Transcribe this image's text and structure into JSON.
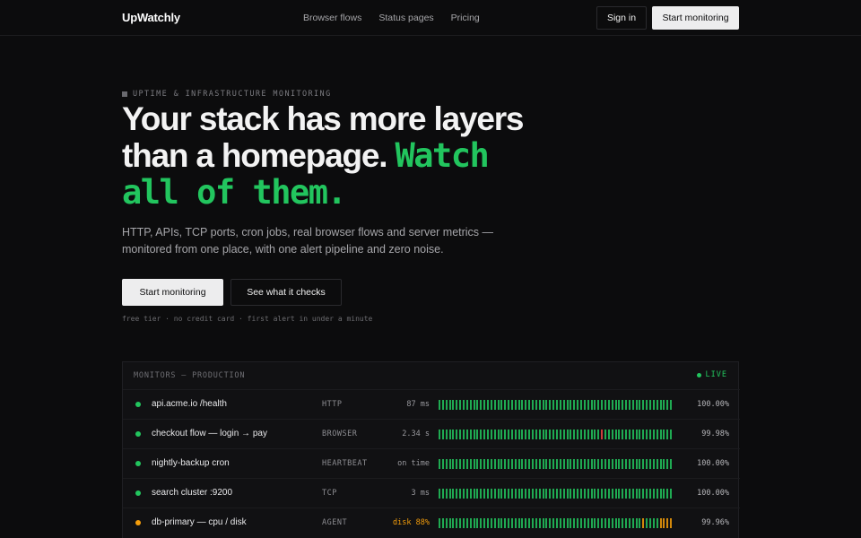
{
  "nav": {
    "logo": "Watchly",
    "logo_mark": "Up",
    "links": [
      "Browser flows",
      "Status pages",
      "Pricing"
    ],
    "sign_in": "Sign in",
    "start": "Start monitoring"
  },
  "hero": {
    "eyebrow": "UPTIME & INFRASTRUCTURE MONITORING",
    "headline_line1": "Your stack has more layers",
    "headline_line2": "than a homepage.",
    "headline_accent_1": "Watch",
    "headline_accent_2": "all of them.",
    "subhead": "HTTP, APIs, TCP ports, cron jobs, real browser flows and server metrics — monitored from one place, with one alert pipeline and zero noise.",
    "cta_primary": "Start monitoring",
    "cta_secondary": "See what it checks",
    "fineprint": "free tier · no credit card · first alert in under a minute"
  },
  "panel": {
    "title": "MONITORS — PRODUCTION",
    "live_label": "LIVE",
    "monitors": [
      {
        "name": "api.acme.io /health",
        "type": "HTTP",
        "metric": "87 ms",
        "uptime": "100.00%",
        "status_color": "#22c55e",
        "metric_color": "#9a9a9f",
        "bars": {
          "count": 68,
          "warn": [],
          "fail": []
        }
      },
      {
        "name": "checkout flow — login → pay",
        "type": "BROWSER",
        "metric": "2.34 s",
        "uptime": "99.98%",
        "status_color": "#22c55e",
        "metric_color": "#9a9a9f",
        "bars": {
          "count": 68,
          "warn": [],
          "fail": [
            47
          ]
        }
      },
      {
        "name": "nightly-backup cron",
        "type": "HEARTBEAT",
        "metric": "on time",
        "uptime": "100.00%",
        "status_color": "#22c55e",
        "metric_color": "#9a9a9f",
        "bars": {
          "count": 68,
          "warn": [],
          "fail": []
        }
      },
      {
        "name": "search cluster :9200",
        "type": "TCP",
        "metric": "3 ms",
        "uptime": "100.00%",
        "status_color": "#22c55e",
        "metric_color": "#9a9a9f",
        "bars": {
          "count": 68,
          "warn": [],
          "fail": []
        }
      },
      {
        "name": "db-primary — cpu / disk",
        "type": "AGENT",
        "metric": "disk 88%",
        "uptime": "99.96%",
        "status_color": "#f59e0b",
        "metric_color": "#f59e0b",
        "bars": {
          "count": 68,
          "warn": [
            59,
            64,
            65,
            66,
            67
          ],
          "fail": []
        }
      }
    ],
    "colors": {
      "ok": "#22c55e",
      "warn": "#f59e0b",
      "fail": "#ef4444"
    }
  }
}
